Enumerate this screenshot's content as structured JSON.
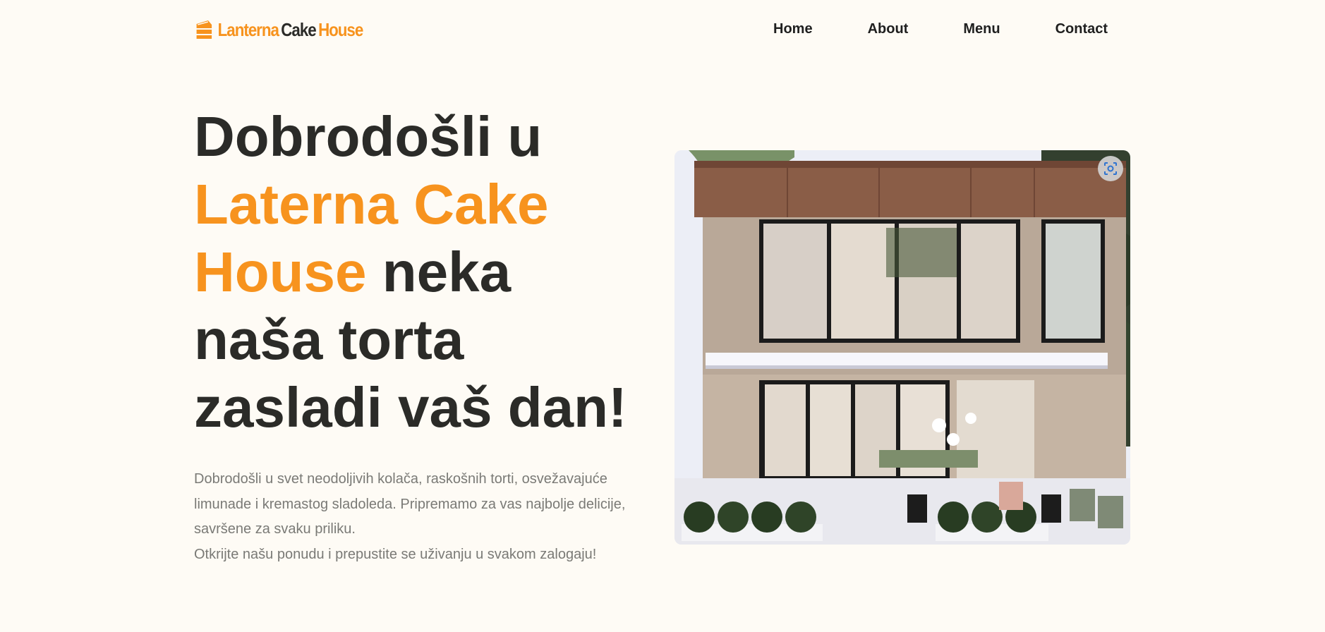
{
  "brand": {
    "logo_word1": "Lanterna",
    "logo_word2": "Cake",
    "logo_word3": "House",
    "accent_color": "#f7931e"
  },
  "nav": {
    "items": [
      {
        "label": "Home"
      },
      {
        "label": "About"
      },
      {
        "label": "Menu"
      },
      {
        "label": "Contact"
      }
    ]
  },
  "hero": {
    "title_part1": "Dobrodošli u",
    "title_accent": "Laterna Cake House",
    "title_part2": "neka naša torta zasladi vaš dan!",
    "description_line1": "Dobrodošli u svet neodoljivih kolača, raskošnih torti, osvežavajuće limunade i kremastog sladoleda. Pripremamo za vas najbolje delicije, savršene za svaku priliku.",
    "description_line2": "Otkrijte našu ponudu i prepustite se uživanju u svakom zalogaju!"
  },
  "image": {
    "subject": "cafe-building-exterior",
    "overlay_icon": "lens-search-icon"
  }
}
